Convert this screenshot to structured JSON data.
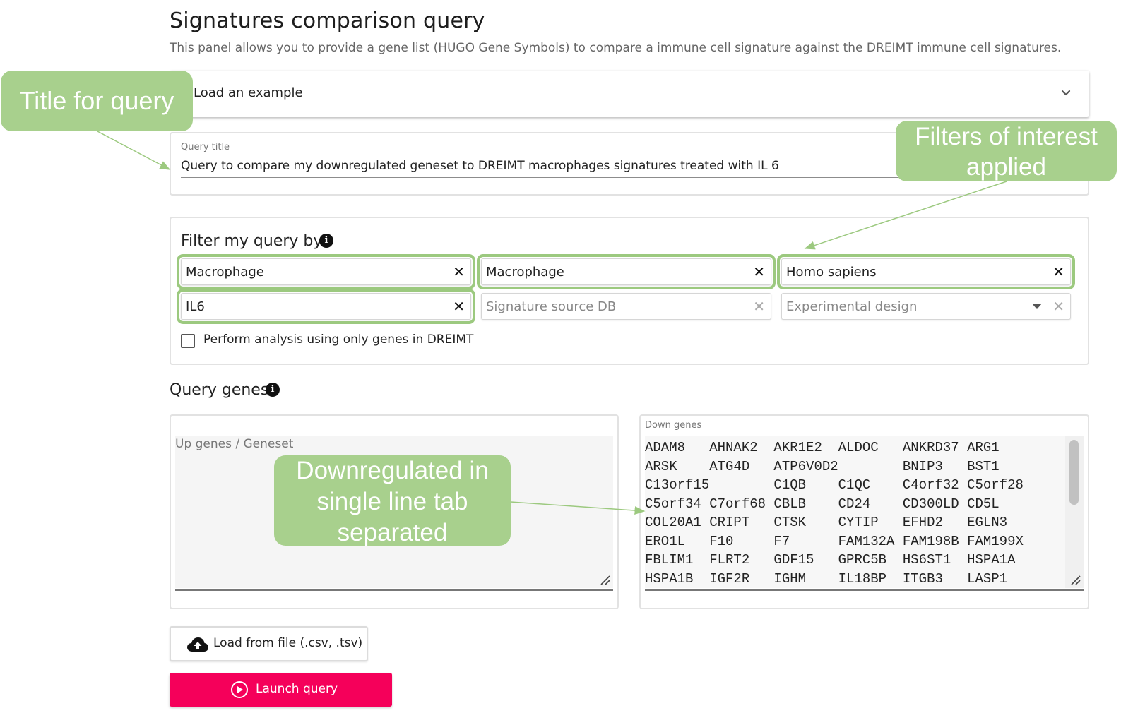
{
  "header": {
    "title": "Signatures comparison query",
    "subtitle": "This panel allows you to provide a gene list (HUGO Gene Symbols) to compare a immune cell signature against the DREIMT immune cell signatures."
  },
  "example_panel": {
    "label": "Load an example",
    "icon": "chevron-down-icon"
  },
  "query_title": {
    "label": "Query title",
    "value": "Query to compare my downregulated geneset to DREIMT macrophages signatures treated with IL 6"
  },
  "filters": {
    "heading": "Filter my query by:",
    "info_icon": "i",
    "chips": [
      {
        "value": "Macrophage",
        "clear": "✕"
      },
      {
        "value": "Macrophage",
        "clear": "✕"
      },
      {
        "value": "Homo sapiens",
        "clear": "✕"
      },
      {
        "value": "IL6",
        "clear": "✕"
      }
    ],
    "signature_source_placeholder": "Signature source DB",
    "experimental_design_placeholder": "Experimental design",
    "clear_dim": "✕",
    "checkbox_label": "Perform analysis using only genes in DREIMT",
    "checkbox_checked": false
  },
  "query_genes": {
    "heading": "Query genes",
    "info_icon": "i",
    "up_placeholder": "Up genes / Geneset",
    "down_label": "Down genes",
    "down_rows": [
      [
        "ADAM8",
        "AHNAK2",
        "AKR1E2",
        "ALDOC",
        "ANKRD37",
        "ARG1"
      ],
      [
        "ARSK",
        "ATG4D",
        "ATP6V0D2",
        "",
        "BNIP3",
        "BST1"
      ],
      [
        "C13orf15",
        "",
        "C1QB",
        "C1QC",
        "C4orf32",
        "C5orf28"
      ],
      [
        "C5orf34",
        "C7orf68",
        "CBLB",
        "CD24",
        "CD300LD",
        "CD5L"
      ],
      [
        "COL20A1",
        "CRIPT",
        "CTSK",
        "CYTIP",
        "EFHD2",
        "EGLN3"
      ],
      [
        "ERO1L",
        "F10",
        "F7",
        "FAM132A",
        "FAM198B",
        "FAM199X"
      ],
      [
        "FBLIM1",
        "FLRT2",
        "GDF15",
        "GPRC5B",
        "HS6ST1",
        "HSPA1A"
      ],
      [
        "HSPA1B",
        "IGF2R",
        "IGHM",
        "IL18BP",
        "ITGB3",
        "LASP1"
      ]
    ]
  },
  "buttons": {
    "load_file": "Load from file (.csv, .tsv)",
    "load_icon": "cloud-upload-icon",
    "launch": "Launch query",
    "launch_icon": "play-circle-icon",
    "launch_color": "#f5005a"
  },
  "annotations": {
    "title_callout": "Title for query",
    "filters_callout_line1": "Filters of interest",
    "filters_callout_line2": "applied",
    "down_callout_line1": "Downregulated in",
    "down_callout_line2": "single line tab",
    "down_callout_line3": "separated",
    "callout_color": "#a8d08d"
  }
}
